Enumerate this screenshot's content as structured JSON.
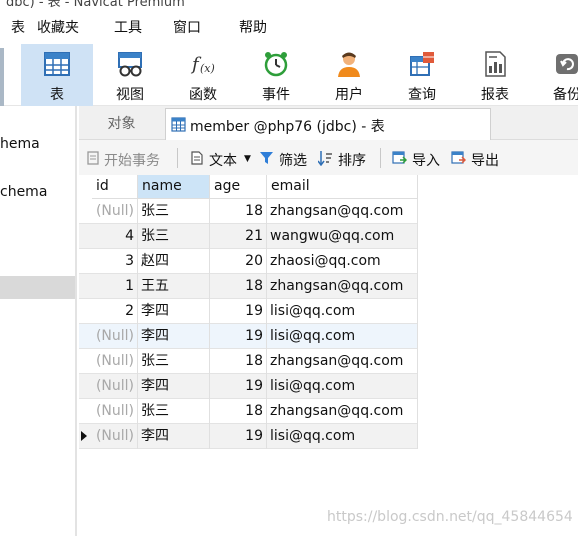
{
  "titlebar": {
    "text": "dbc) - 表 - Navicat Premium"
  },
  "menu": {
    "items": [
      "表",
      "收藏夹",
      "工具",
      "窗口",
      "帮助"
    ]
  },
  "toolbar": {
    "buttons": [
      {
        "label": "表",
        "icon": "table-icon"
      },
      {
        "label": "视图",
        "icon": "view-icon"
      },
      {
        "label": "函数",
        "icon": "function-icon"
      },
      {
        "label": "事件",
        "icon": "event-clock-icon"
      },
      {
        "label": "用户",
        "icon": "user-icon"
      },
      {
        "label": "查询",
        "icon": "query-icon"
      },
      {
        "label": "报表",
        "icon": "report-icon"
      },
      {
        "label": "备份",
        "icon": "backup-icon"
      }
    ]
  },
  "sidebar": {
    "items": [
      "hema",
      "chema"
    ]
  },
  "tabs": {
    "objects_label": "对象",
    "active_title": "member @php76 (jdbc) - 表"
  },
  "subtoolbar": {
    "begin_transaction": "开始事务",
    "text": "文本",
    "filter": "筛选",
    "sort": "排序",
    "import": "导入",
    "export": "导出"
  },
  "table": {
    "columns": [
      "id",
      "name",
      "age",
      "email"
    ],
    "rows": [
      {
        "id": "(Null)",
        "name": "张三",
        "age": "18",
        "email": "zhangsan@qq.com"
      },
      {
        "id": "4",
        "name": "张三",
        "age": "21",
        "email": "wangwu@qq.com"
      },
      {
        "id": "3",
        "name": "赵四",
        "age": "20",
        "email": "zhaosi@qq.com"
      },
      {
        "id": "1",
        "name": "王五",
        "age": "18",
        "email": "zhangsan@qq.com"
      },
      {
        "id": "2",
        "name": "李四",
        "age": "19",
        "email": "lisi@qq.com"
      },
      {
        "id": "(Null)",
        "name": "李四",
        "age": "19",
        "email": "lisi@qq.com"
      },
      {
        "id": "(Null)",
        "name": "张三",
        "age": "18",
        "email": "zhangsan@qq.com"
      },
      {
        "id": "(Null)",
        "name": "李四",
        "age": "19",
        "email": "lisi@qq.com"
      },
      {
        "id": "(Null)",
        "name": "张三",
        "age": "18",
        "email": "zhangsan@qq.com"
      },
      {
        "id": "(Null)",
        "name": "李四",
        "age": "19",
        "email": "lisi@qq.com"
      }
    ]
  },
  "watermark": "https://blog.csdn.net/qq_45844654",
  "colors": {
    "active_tool": "#cfe2f5",
    "selected_header": "#cde4f7",
    "null_text": "#a8a8a8"
  }
}
